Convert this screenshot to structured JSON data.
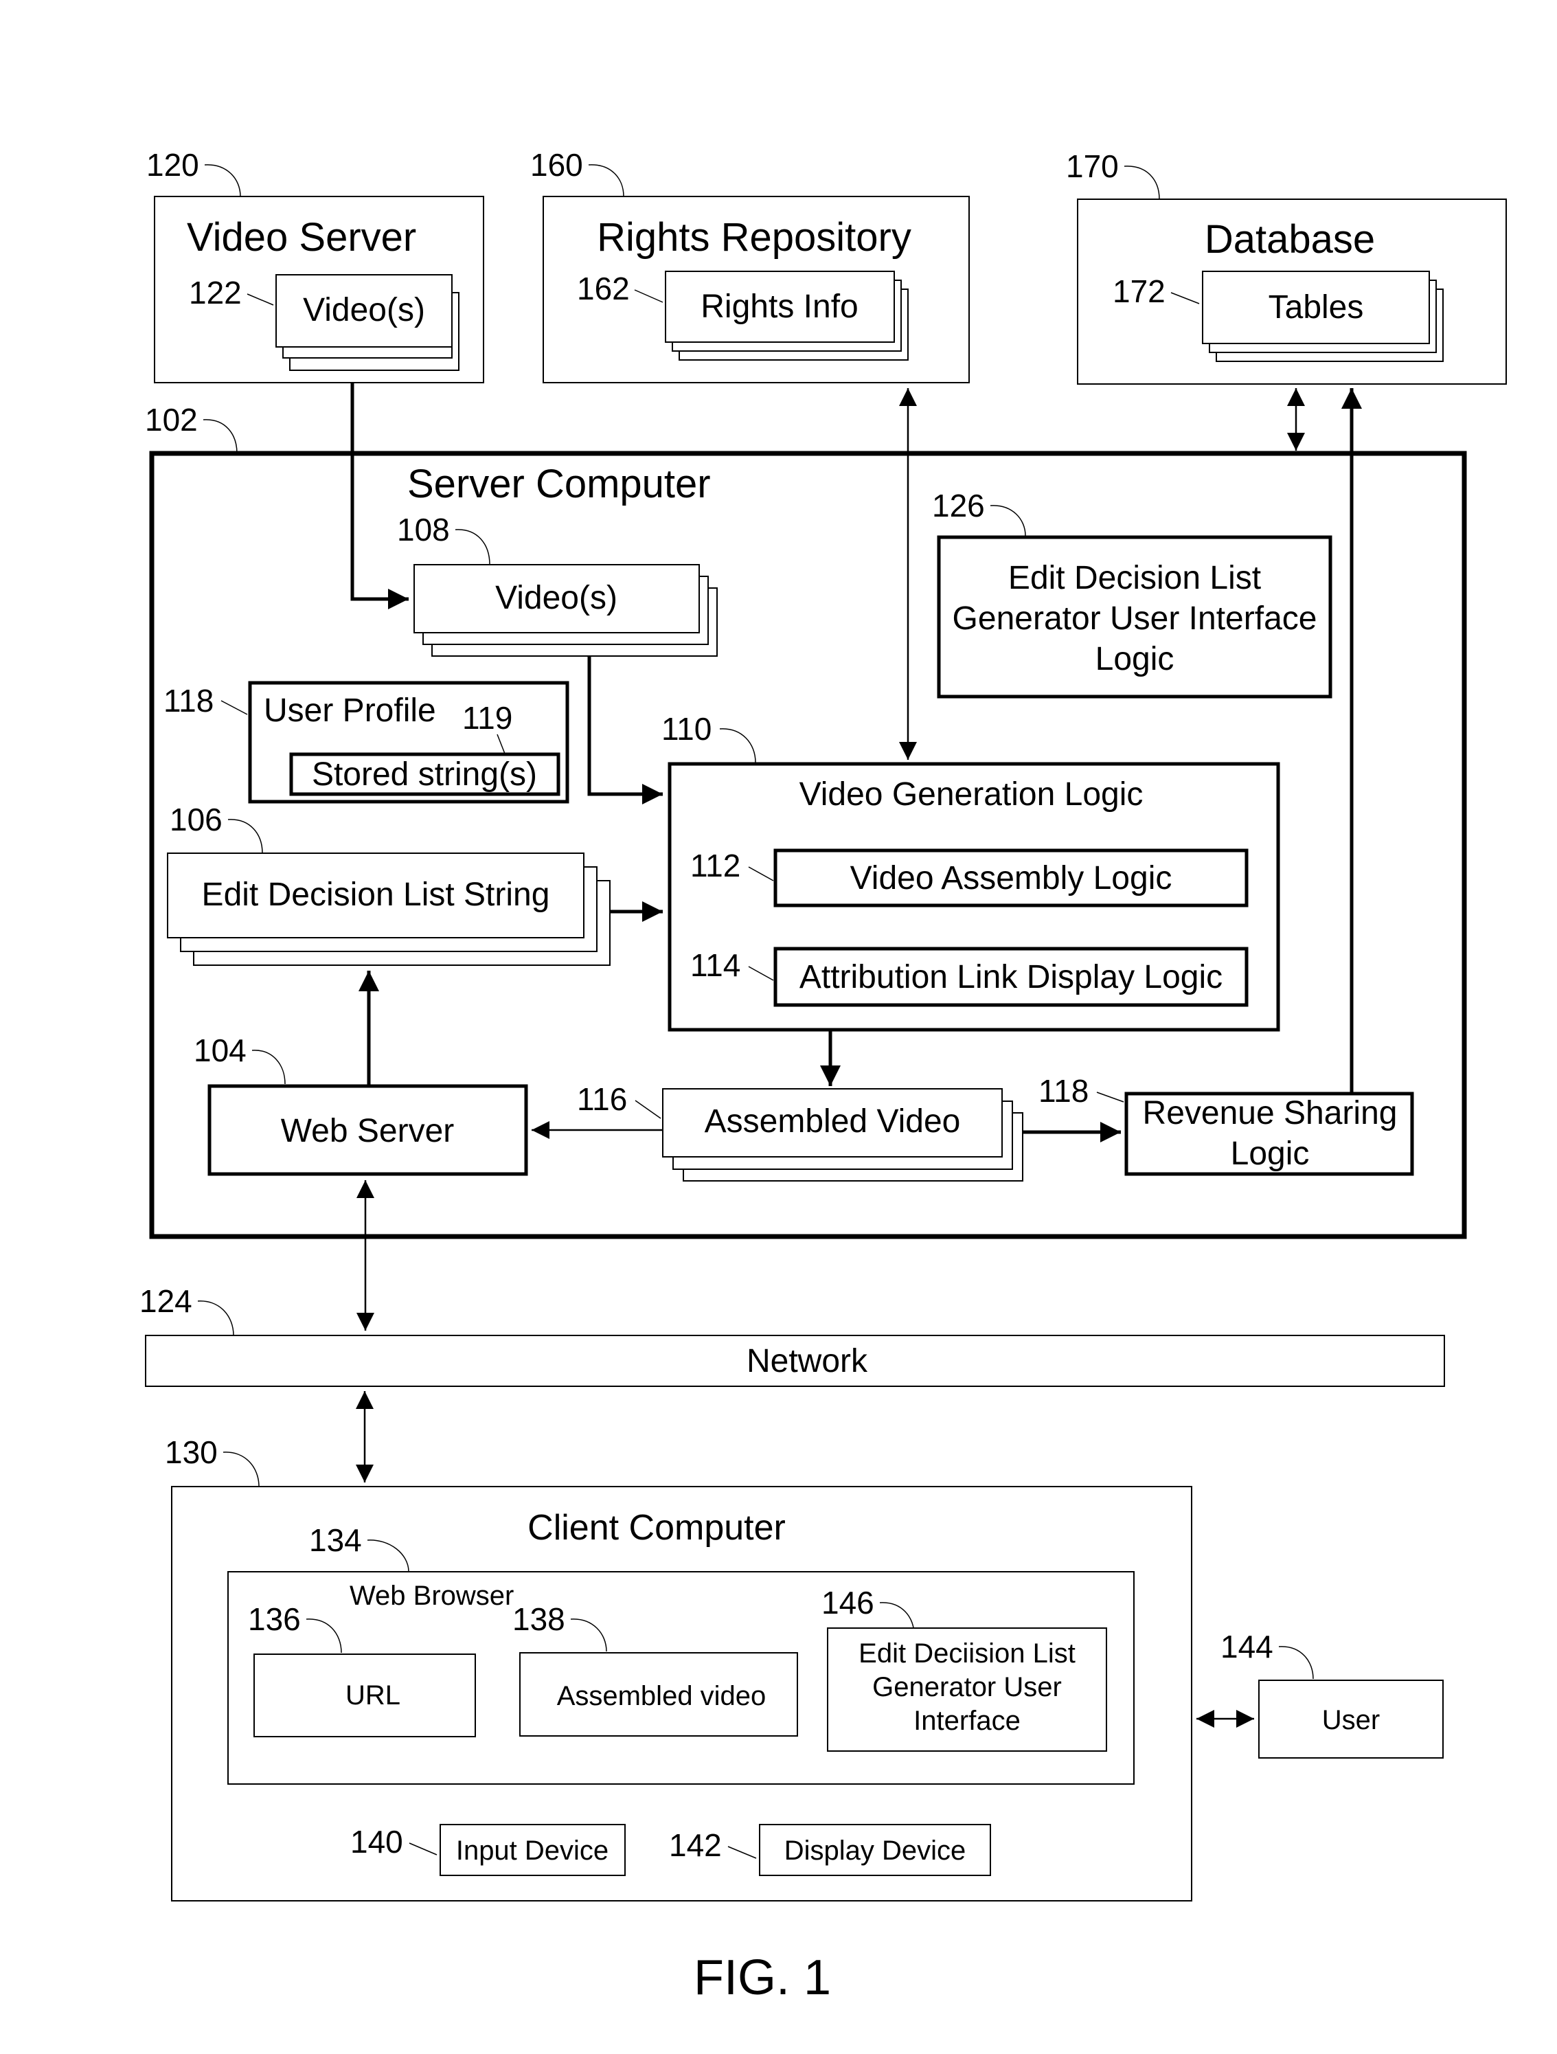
{
  "figure": {
    "caption": "FIG. 1",
    "nodes": {
      "video_server": {
        "ref": "120",
        "title": "Video Server"
      },
      "video_server_videos": {
        "ref": "122",
        "label": "Video(s)"
      },
      "rights_repository": {
        "ref": "160",
        "title": "Rights Repository"
      },
      "rights_info": {
        "ref": "162",
        "label": "Rights Info"
      },
      "database": {
        "ref": "170",
        "title": "Database"
      },
      "tables": {
        "ref": "172",
        "label": "Tables"
      },
      "server_computer": {
        "ref": "102",
        "title": "Server Computer"
      },
      "server_videos": {
        "ref": "108",
        "label": "Video(s)"
      },
      "edl_ui_logic": {
        "ref": "126",
        "lines": [
          "Edit Decision List",
          "Generator User Interface",
          "Logic"
        ]
      },
      "user_profile": {
        "ref": "118",
        "title": "User Profile"
      },
      "stored_strings": {
        "ref": "119",
        "label": "Stored string(s)"
      },
      "edl_string": {
        "ref": "106",
        "label": "Edit Decision List String"
      },
      "video_generation_logic": {
        "ref": "110",
        "title": "Video Generation Logic"
      },
      "video_assembly_logic": {
        "ref": "112",
        "label": "Video Assembly Logic"
      },
      "attribution_link_logic": {
        "ref": "114",
        "label": "Attribution Link Display Logic"
      },
      "web_server": {
        "ref": "104",
        "label": "Web Server"
      },
      "assembled_video": {
        "ref": "116",
        "label": "Assembled Video"
      },
      "revenue_sharing": {
        "ref": "118",
        "lines": [
          "Revenue Sharing",
          "Logic"
        ]
      },
      "network": {
        "ref": "124",
        "label": "Network"
      },
      "client_computer": {
        "ref": "130",
        "title": "Client Computer"
      },
      "web_browser": {
        "ref": "134",
        "title": "Web Browser"
      },
      "url": {
        "ref": "136",
        "label": "URL"
      },
      "client_assembled_video": {
        "ref": "138",
        "label": "Assembled video"
      },
      "edl_generator_ui": {
        "ref": "146",
        "lines": [
          "Edit Deciision List",
          "Generator User",
          "Interface"
        ]
      },
      "input_device": {
        "ref": "140",
        "label": "Input Device"
      },
      "display_device": {
        "ref": "142",
        "label": "Display Device"
      },
      "user": {
        "ref": "144",
        "label": "User"
      }
    },
    "connections": [
      {
        "from": "video_server_videos",
        "to": "server_videos",
        "type": "arrow"
      },
      {
        "from": "video_generation_logic",
        "to": "rights_repository",
        "type": "bidirectional"
      },
      {
        "from": "server_computer",
        "to": "database",
        "type": "bidirectional"
      },
      {
        "from": "revenue_sharing",
        "to": "database",
        "type": "arrow"
      },
      {
        "from": "server_videos",
        "to": "video_generation_logic",
        "type": "arrow"
      },
      {
        "from": "edl_string",
        "to": "video_generation_logic",
        "type": "arrow"
      },
      {
        "from": "web_server",
        "to": "edl_string",
        "type": "arrow"
      },
      {
        "from": "video_generation_logic",
        "to": "assembled_video",
        "type": "arrow"
      },
      {
        "from": "assembled_video",
        "to": "web_server",
        "type": "arrow"
      },
      {
        "from": "assembled_video",
        "to": "revenue_sharing",
        "type": "arrow"
      },
      {
        "from": "web_server",
        "to": "network",
        "type": "bidirectional"
      },
      {
        "from": "network",
        "to": "client_computer",
        "type": "bidirectional"
      },
      {
        "from": "client_computer",
        "to": "user",
        "type": "bidirectional"
      }
    ]
  }
}
